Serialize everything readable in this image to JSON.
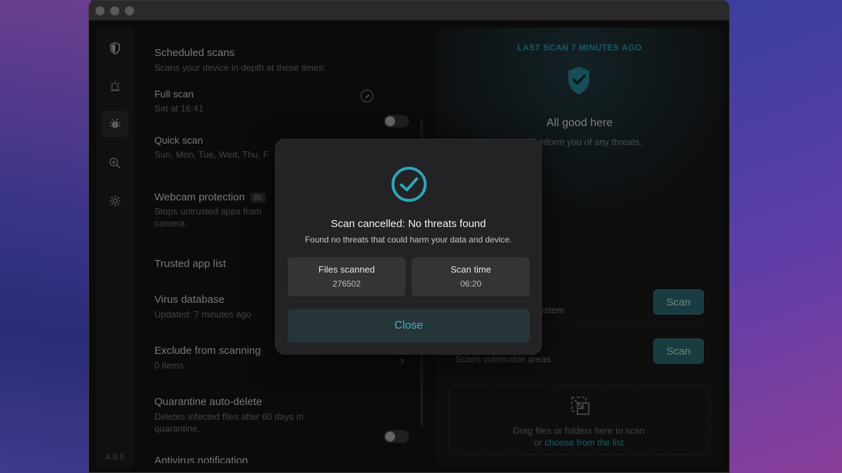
{
  "app": {
    "version": "4.9.5"
  },
  "sidebar": {
    "items": [
      {
        "icon": "shield-icon"
      },
      {
        "icon": "alarm-icon"
      },
      {
        "icon": "bug-icon"
      },
      {
        "icon": "search-bug-icon"
      },
      {
        "icon": "gear-icon"
      }
    ]
  },
  "settings": {
    "scheduled": {
      "title": "Scheduled scans",
      "subtitle": "Scans your device in depth at these times:"
    },
    "full_scan": {
      "title": "Full scan",
      "time": "Sat at 16:41"
    },
    "quick_scan": {
      "title": "Quick scan",
      "days": "Sun, Mon, Tue, Wed, Thu, F"
    },
    "webcam": {
      "title": "Webcam protection",
      "badge": "BE",
      "subtitle_line1": "Stops untrusted apps from",
      "subtitle_line2": "camera."
    },
    "trusted": {
      "title": "Trusted app list"
    },
    "virus_db": {
      "title": "Virus database",
      "subtitle": "Updated: 7 minutes ago"
    },
    "exclude": {
      "title": "Exclude from scanning",
      "subtitle": "0 items"
    },
    "quarantine": {
      "title": "Quarantine auto-delete",
      "subtitle_line1": "Deletes infected files after 60 days in",
      "subtitle_line2": "quarantine."
    },
    "antivirus_notif": {
      "title": "Antivirus notification"
    }
  },
  "right_panel": {
    "last_scan": "LAST SCAN 7 MINUTES AGO",
    "status_title": "All good here",
    "status_sub": "We'll inform you of any threats.",
    "full_scan_desc": "ystem",
    "quick_scan_desc": "Scans vulnerable areas",
    "scan_label": "Scan",
    "drop_line1": "Drag files or folders here to scan",
    "drop_or": "or ",
    "drop_link": "choose from the list"
  },
  "modal": {
    "title": "Scan cancelled: No threats found",
    "subtitle": "Found no threats that could harm your data and device.",
    "files_label": "Files scanned",
    "files_value": "276502",
    "time_label": "Scan time",
    "time_value": "06:20",
    "close_label": "Close"
  },
  "colors": {
    "accent": "#2fa6b6",
    "scan_button": "#2d6e76"
  }
}
